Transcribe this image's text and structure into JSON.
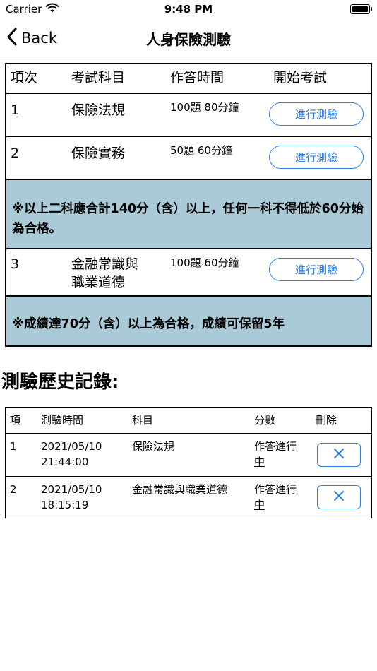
{
  "status_bar": {
    "carrier": "Carrier",
    "time": "9:48 PM"
  },
  "nav": {
    "back_label": "Back",
    "title": "人身保險測驗"
  },
  "exam_table": {
    "headers": [
      "項次",
      "考試科目",
      "作答時間",
      "開始考試"
    ],
    "rows": [
      {
        "no": "1",
        "subject": "保險法規",
        "time": "100題 80分鐘",
        "button": "進行測驗"
      },
      {
        "no": "2",
        "subject": "保險實務",
        "time": "50題 60分鐘",
        "button": "進行測驗"
      },
      {
        "no": "3",
        "subject_line1": "金融常識與",
        "subject_line2": "職業道德",
        "time": "100題 60分鐘",
        "button": "進行測驗"
      }
    ],
    "note1": "※以上二科應合計140分（含）以上，任何一科不得低於60分始為合格。",
    "note2": "※成績達70分（含）以上為合格，成績可保留5年"
  },
  "history": {
    "title": "測驗歷史記錄:",
    "headers": [
      "項",
      "測驗時間",
      "科目",
      "分數",
      "刪除"
    ],
    "rows": [
      {
        "no": "1",
        "date": "2021/05/10",
        "time": "21:44:00",
        "subject": "保險法規",
        "score_line1": "作答進行",
        "score_line2": "中"
      },
      {
        "no": "2",
        "date": "2021/05/10",
        "time": "18:15:19",
        "subject": "金融常識與職業道德",
        "score_line1": "作答進行",
        "score_line2": "中"
      }
    ]
  },
  "colors": {
    "accent": "#2f7de0",
    "note_bg": "#a9cad6"
  },
  "icons": {
    "back": "chevron-left-icon",
    "delete": "close-icon",
    "wifi": "wifi-icon",
    "battery": "battery-icon"
  }
}
